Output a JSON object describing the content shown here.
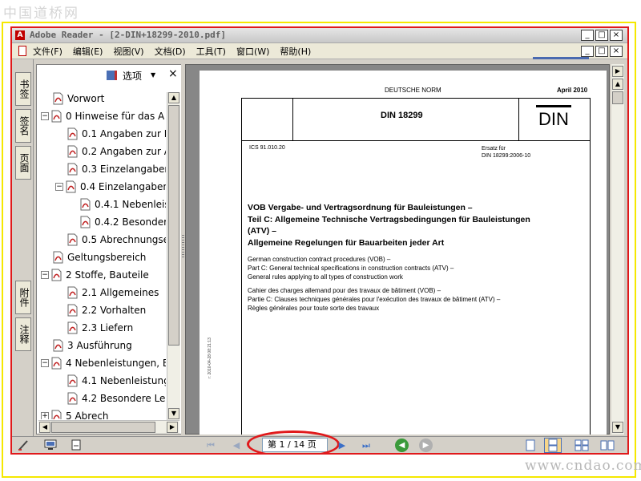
{
  "watermark_top": "中国道桥网",
  "watermark_bottom": "www.cndao.com",
  "window": {
    "title": "Adobe Reader - [2-DIN+18299-2010.pdf]",
    "min": "_",
    "max": "□",
    "close": "×"
  },
  "menu": [
    "文件(F)",
    "编辑(E)",
    "视图(V)",
    "文档(D)",
    "工具(T)",
    "窗口(W)",
    "帮助(H)"
  ],
  "side_tabs": {
    "bookmarks": "书签",
    "signatures": "签名",
    "pages": "页面",
    "attachments": "附件",
    "comments": "注释"
  },
  "bookmarks_panel": {
    "options_label": "选项",
    "close": "×",
    "items": [
      {
        "label": "Vorwort",
        "expander": ""
      },
      {
        "label": "0 Hinweise für das A",
        "expander": "−"
      },
      {
        "label": "0.1 Angaben zur B",
        "expander": ""
      },
      {
        "label": "0.2 Angaben zur A",
        "expander": ""
      },
      {
        "label": "0.3 Einzelangaben",
        "expander": ""
      },
      {
        "label": "0.4 Einzelangaben",
        "expander": "−"
      },
      {
        "label": "0.4.1 Nebenleis",
        "expander": ""
      },
      {
        "label": "0.4.2 Besonder",
        "expander": ""
      },
      {
        "label": "0.5 Abrechnungse",
        "expander": ""
      },
      {
        "label": "Geltungsbereich",
        "expander": ""
      },
      {
        "label": "2 Stoffe, Bauteile",
        "expander": "−"
      },
      {
        "label": "2.1 Allgemeines",
        "expander": ""
      },
      {
        "label": "2.2 Vorhalten",
        "expander": ""
      },
      {
        "label": "2.3 Liefern",
        "expander": ""
      },
      {
        "label": "3 Ausführung",
        "expander": ""
      },
      {
        "label": "4 Nebenleistungen, B",
        "expander": "−"
      },
      {
        "label": "4.1 Nebenleistung",
        "expander": ""
      },
      {
        "label": "4.2 Besondere Lei",
        "expander": ""
      },
      {
        "label": "5 Abrech",
        "expander": "+"
      }
    ]
  },
  "document": {
    "header_left": "DEUTSCHE NORM",
    "header_right": "April 2010",
    "din_number": "DIN 18299",
    "logo_text": "DIN",
    "ics": "ICS 91.010.20",
    "ersatz_line1": "Ersatz für",
    "ersatz_line2": "DIN 18299:2006-10",
    "title_de_1": "VOB Vergabe- und Vertragsordnung für Bauleistungen –",
    "title_de_2": "Teil C: Allgemeine Technische Vertragsbedingungen für Bauleistungen",
    "title_de_3": "(ATV) –",
    "title_de_4": "Allgemeine Regelungen für Bauarbeiten jeder Art",
    "title_en_1": "German construction contract procedures (VOB) –",
    "title_en_2": "Part C: General technical specifications in construction contracts (ATV) –",
    "title_en_3": "General rules applying to all types of construction work",
    "title_fr_1": "Cahier des charges allemand pour des travaux de bâtiment (VOB) –",
    "title_fr_2": "Partie C: Clauses techniques générales pour l'exécution des travaux de bâtiment (ATV) –",
    "title_fr_3": "Règles générales pour toute sorte des travaux",
    "side_stamp": "r: 2010-04-28 08:21:13"
  },
  "navigation": {
    "page_indicator": "第 1 / 14 页",
    "first": "⏮",
    "prev": "◀",
    "next": "▶",
    "last": "⏭",
    "back": "◀",
    "forward": "▶"
  },
  "colors": {
    "annotation_red": "#e0191b",
    "frame_yellow": "#f5e800",
    "nav_blue": "#3a6fc8",
    "go_green": "#3a9a3a"
  }
}
